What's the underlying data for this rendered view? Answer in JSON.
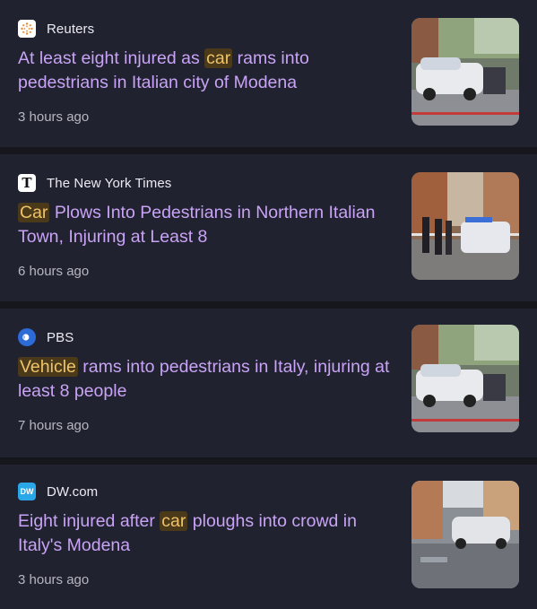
{
  "articles": [
    {
      "source": "Reuters",
      "logo_icon": "reuters-logo-icon",
      "headline_before": "At least eight injured as ",
      "headline_keyword": "car",
      "headline_after": " rams into pedestrians in Italian city of Modena",
      "time": "3 hours ago"
    },
    {
      "source": "The New York Times",
      "logo_icon": "nyt-logo-icon",
      "headline_before": "",
      "headline_keyword": "Car",
      "headline_after": " Plows Into Pedestrians in Northern Italian Town, Injuring at Least 8",
      "time": "6 hours ago"
    },
    {
      "source": "PBS",
      "logo_icon": "pbs-logo-icon",
      "headline_before": "",
      "headline_keyword": "Vehicle",
      "headline_after": " rams into pedestrians in Italy, injuring at least 8 people",
      "time": "7 hours ago"
    },
    {
      "source": "DW.com",
      "logo_icon": "dw-logo-icon",
      "headline_before": "Eight injured after ",
      "headline_keyword": "car",
      "headline_after": " ploughs into crowd in Italy's Modena",
      "time": "3 hours ago"
    }
  ],
  "colors": {
    "background": "#16161d",
    "card": "#202230",
    "headline": "#c9a3f5",
    "keyword_text": "#f0c36a",
    "keyword_bg": "#4a3a1a",
    "meta_text": "#b8b6c0"
  }
}
